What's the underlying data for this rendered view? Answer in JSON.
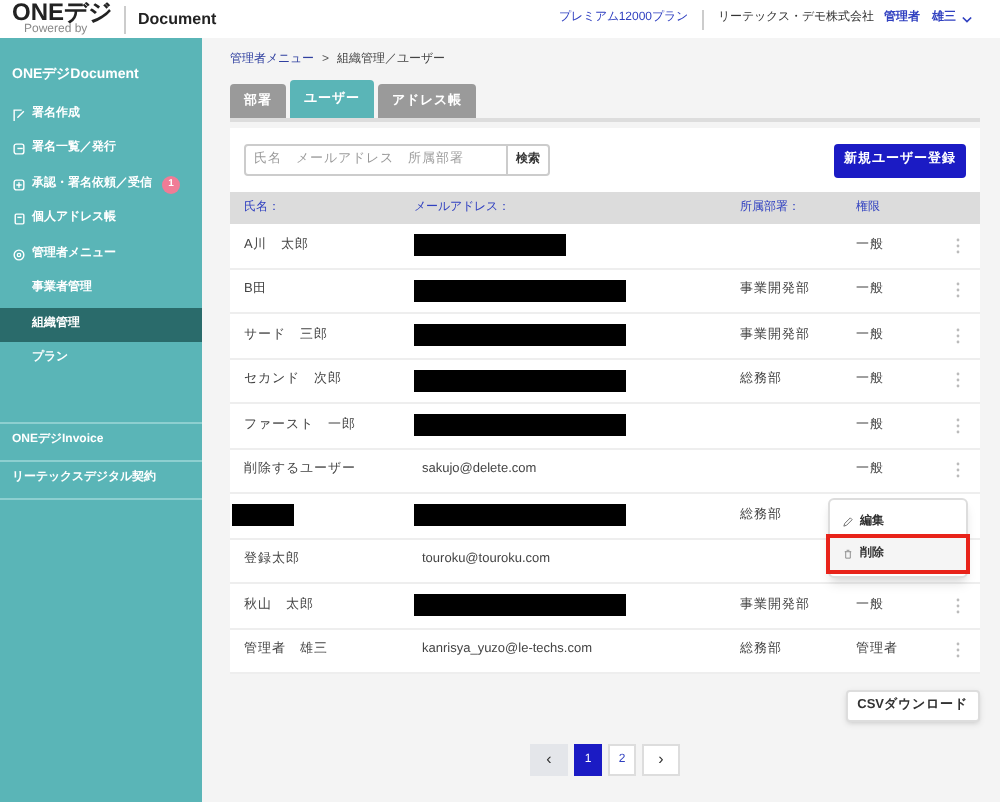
{
  "header": {
    "logo": "ONEデジ",
    "logo_sub": "Powered by",
    "product": "Document",
    "plan": "プレミアム12000プラン",
    "company": "リーテックス・デモ株式会社",
    "role": "管理者",
    "user": "雄三"
  },
  "sidebar": {
    "title": "ONEデジDocument",
    "items": [
      {
        "kind": "main",
        "label": "署名作成",
        "selected": false
      },
      {
        "kind": "main",
        "label": "署名一覧／発行",
        "selected": false
      },
      {
        "kind": "main",
        "label": "承認・署名依頼／受信",
        "badge": "1",
        "selected": false
      },
      {
        "kind": "main",
        "label": "個人アドレス帳",
        "selected": false
      },
      {
        "kind": "main",
        "label": "管理者メニュー",
        "selected": false
      },
      {
        "kind": "sub",
        "label": "事業者管理",
        "selected": false
      },
      {
        "kind": "sub",
        "label": "組織管理",
        "selected": true
      },
      {
        "kind": "sub",
        "label": "プラン",
        "selected": false
      }
    ],
    "sections": [
      "ONEデジInvoice",
      "リーテックスデジタル契約"
    ]
  },
  "breadcrumb": {
    "link": "管理者メニュー",
    "separator": ">",
    "current": "組織管理／ユーザー"
  },
  "tabs": [
    {
      "label": "部署",
      "selected": false
    },
    {
      "label": "ユーザー",
      "selected": true
    },
    {
      "label": "アドレス帳",
      "selected": false
    }
  ],
  "search": {
    "placeholder": "氏名　メールアドレス　所属部署",
    "button": "検索"
  },
  "new_button": "新規ユーザー登録",
  "table": {
    "columns": [
      "氏名：",
      "メールアドレス：",
      "所属部署：",
      "権限"
    ],
    "rows": [
      {
        "name": "A川　太郎",
        "email_redacted": true,
        "role": "一般"
      },
      {
        "name": "B田",
        "email_redacted": true,
        "department": "事業開発部",
        "role": "一般"
      },
      {
        "name": "サード　三郎",
        "email_redacted": true,
        "department": "事業開発部",
        "role": "一般"
      },
      {
        "name": "セカンド　次郎",
        "email_redacted": true,
        "department": "総務部",
        "role": "一般"
      },
      {
        "name": "ファースト　一郎",
        "email_redacted": true,
        "role": "一般"
      },
      {
        "name": "削除するユーザー",
        "email": "sakujo@delete.com",
        "role": "一般",
        "menu_open": true
      },
      {
        "name_redacted": true,
        "email_redacted": true,
        "department": "総務部"
      },
      {
        "name": "登録太郎",
        "email": "touroku@touroku.com"
      },
      {
        "name": "秋山　太郎",
        "email_redacted": true,
        "department": "事業開発部",
        "role": "一般"
      },
      {
        "name": "管理者　雄三",
        "email": "kanrisya_yuzo@le-techs.com",
        "department": "総務部",
        "role": "管理者"
      }
    ]
  },
  "row_menu": {
    "items": [
      {
        "label": "編集",
        "highlighted": false
      },
      {
        "label": "削除",
        "highlighted": true
      }
    ]
  },
  "csv_button": "CSVダウンロード",
  "pagination": {
    "prev": "‹",
    "pages": [
      {
        "label": "1",
        "selected": true
      },
      {
        "label": "2",
        "selected": false
      }
    ],
    "next": "›"
  }
}
